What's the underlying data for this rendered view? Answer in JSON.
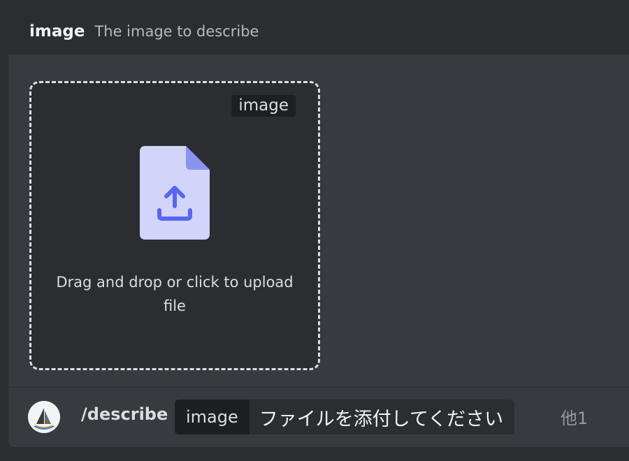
{
  "option_header": {
    "name": "image",
    "description": "The image to describe"
  },
  "dropzone": {
    "tag": "image",
    "text": "Drag and drop or click to upload file",
    "icon": "file-upload-icon"
  },
  "command_bar": {
    "avatar_icon": "bot-avatar-icon",
    "command": "/describe",
    "option_label": "image",
    "option_value": "ファイルを添付してください",
    "more": "他1"
  },
  "colors": {
    "background": "#2b2d31",
    "panel": "#383a40",
    "chip": "#1e1f22",
    "icon_fill": "#d2d4fa",
    "icon_accent": "#5865f2"
  }
}
